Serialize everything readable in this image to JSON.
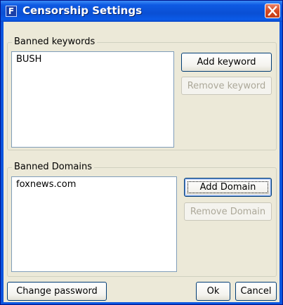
{
  "window": {
    "title": "Censorship Settings",
    "icon_letter": "F",
    "icon": "app-icon",
    "close_icon": "close-icon",
    "colors": {
      "titlebar": "#0b55df",
      "close": "#d64a22",
      "client": "#ece9d8"
    }
  },
  "keywords": {
    "group_label": "Banned keywords",
    "items": [
      "BUSH"
    ],
    "add_label": "Add keyword",
    "remove_label": "Remove keyword"
  },
  "domains": {
    "group_label": "Banned Domains",
    "items": [
      "foxnews.com"
    ],
    "add_label": "Add Domain",
    "remove_label": "Remove Domain"
  },
  "footer": {
    "change_password_label": "Change password",
    "ok_label": "Ok",
    "cancel_label": "Cancel"
  }
}
